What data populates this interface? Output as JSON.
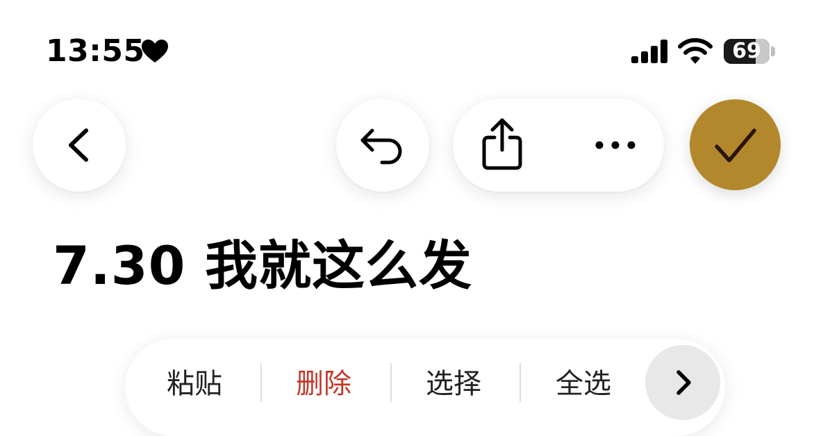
{
  "status_bar": {
    "time": "13:55",
    "battery": "69",
    "battery_level_percent": 69,
    "icons": [
      "heart-icon",
      "cellular-signal-icon",
      "wifi-icon",
      "battery-icon"
    ]
  },
  "toolbar": {
    "icons": [
      "chevron-left-icon",
      "undo-icon",
      "share-icon",
      "more-icon",
      "checkmark-icon"
    ],
    "accent_color": "#b3882c"
  },
  "note": {
    "title": "7.30 我就这么发"
  },
  "edit_menu": {
    "items": [
      {
        "label": "粘贴",
        "destructive": false
      },
      {
        "label": "删除",
        "destructive": true
      },
      {
        "label": "选择",
        "destructive": false
      },
      {
        "label": "全选",
        "destructive": false
      }
    ],
    "next_icon": "chevron-right-icon",
    "destructive_color": "#c0392b"
  }
}
